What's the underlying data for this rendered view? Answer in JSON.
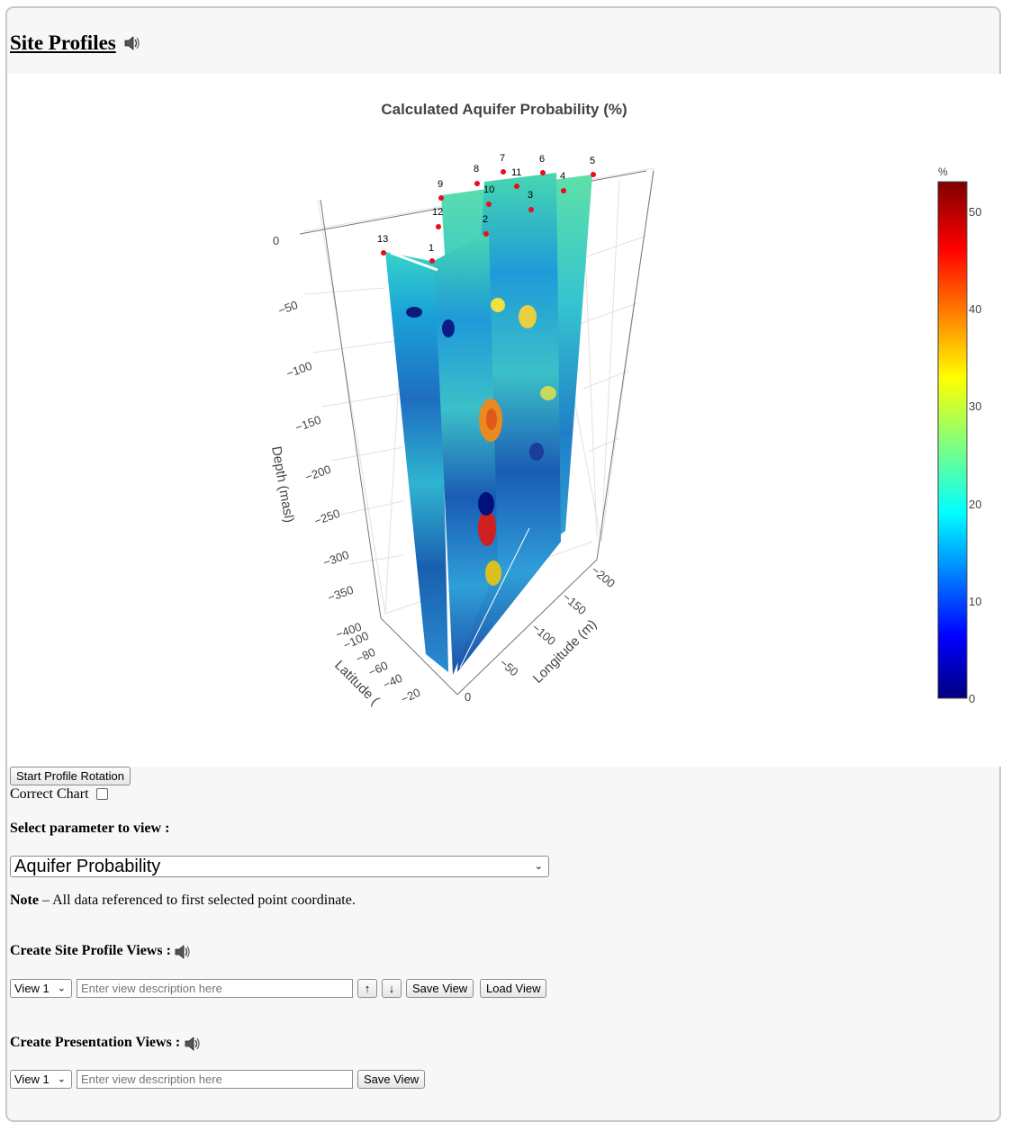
{
  "page": {
    "title": "Site Profiles"
  },
  "chart": {
    "title": "Calculated Aquifer Probability (%)",
    "colorbar": {
      "unit": "%",
      "ticks": [
        "0",
        "10",
        "20",
        "30",
        "40",
        "50"
      ],
      "colorscale": "jet"
    }
  },
  "chart_data": {
    "type": "heatmap",
    "title": "Calculated Aquifer Probability (%)",
    "projection": "3d",
    "zlabel": "Depth (masl)",
    "ylabel": "Longitude (m)",
    "xlabel": "Latitude (",
    "z_ticks": [
      "0",
      "−50",
      "−100",
      "−150",
      "−200",
      "−250",
      "−300",
      "−350",
      "−400"
    ],
    "longitude_ticks": [
      "0",
      "−50",
      "−100",
      "−150",
      "−200"
    ],
    "latitude_ticks": [
      "−100",
      "−80",
      "−60",
      "−40",
      "−20"
    ],
    "colorbar": {
      "title": "%",
      "range": [
        0,
        53
      ],
      "ticks": [
        0,
        10,
        20,
        30,
        40,
        50
      ]
    },
    "points": [
      "1",
      "2",
      "3",
      "4",
      "5",
      "6",
      "7",
      "8",
      "9",
      "10",
      "11",
      "12",
      "13"
    ]
  },
  "controls": {
    "rotation_button": "Start Profile Rotation",
    "correct_chart_label": "Correct Chart",
    "correct_chart_checked": false,
    "select_param_heading": "Select parameter to view :",
    "parameter_selected": "Aquifer Probability",
    "note_bold": "Note",
    "note_text": " – All data referenced to first selected point coordinate."
  },
  "site_views": {
    "heading": "Create Site Profile Views :",
    "view_selected": "View 1",
    "description_placeholder": "Enter view description here",
    "up_label": "↑",
    "down_label": "↓",
    "save_label": "Save View",
    "load_label": "Load View"
  },
  "presentation_views": {
    "heading": "Create Presentation Views :",
    "view_selected": "View 1",
    "description_placeholder": "Enter view description here",
    "save_label": "Save View"
  },
  "icons": {
    "speaker": "speaker-icon"
  }
}
